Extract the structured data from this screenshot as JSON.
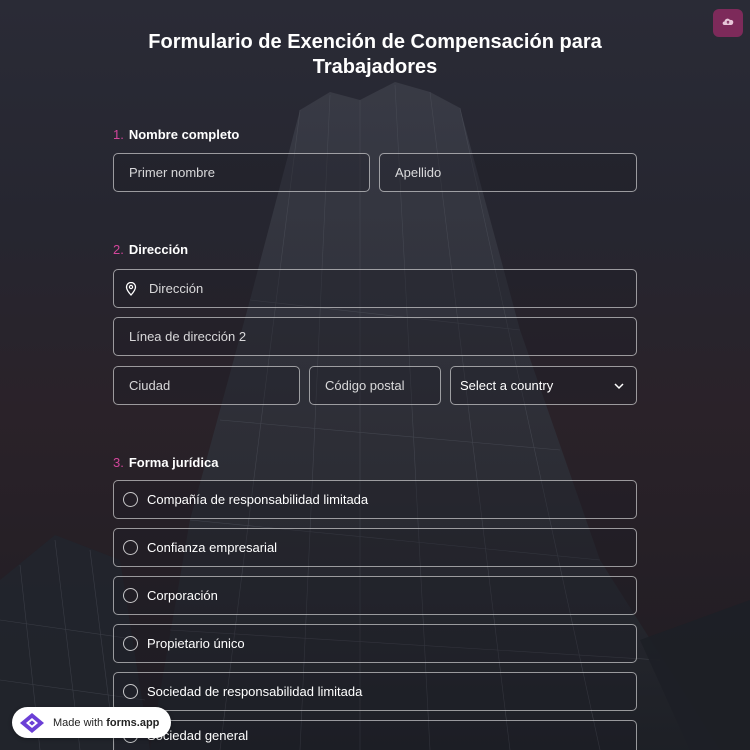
{
  "header": {
    "title": "Formulario de Exención de Compensación para Trabajadores",
    "upload_icon": "cloud-upload-icon",
    "accent_color": "#7d2a5a"
  },
  "questions": {
    "name": {
      "number": "1.",
      "label": "Nombre completo",
      "first_placeholder": "Primer nombre",
      "last_placeholder": "Apellido"
    },
    "address": {
      "number": "2.",
      "label": "Dirección",
      "line1_placeholder": "Dirección",
      "line2_placeholder": "Línea de dirección 2",
      "city_placeholder": "Ciudad",
      "zip_placeholder": "Código postal",
      "country_value": "Select a country",
      "pin_icon": "location-pin-icon",
      "chevron_icon": "chevron-down-icon"
    },
    "legal_form": {
      "number": "3.",
      "label": "Forma jurídica",
      "options": [
        "Compañía de responsabilidad limitada",
        "Confianza empresarial",
        "Corporación",
        "Propietario único",
        "Sociedad de responsabilidad limitada",
        "Sociedad general"
      ]
    }
  },
  "badge": {
    "prefix": "Made with ",
    "brand": "forms.app"
  },
  "colors": {
    "number_accent": "#d1459a",
    "badge_logo": "#6b3fd6"
  }
}
